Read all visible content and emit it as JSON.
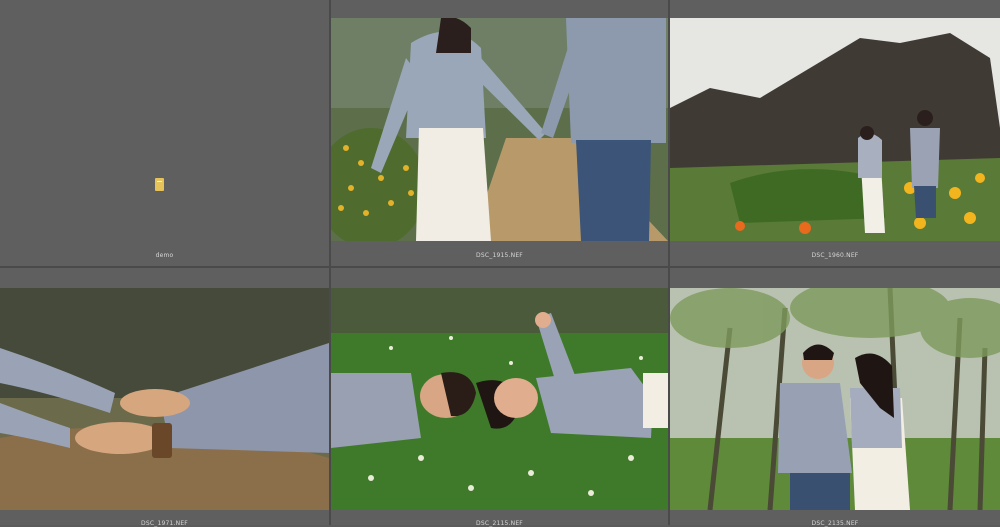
{
  "grid": {
    "cells": [
      {
        "caption": "demo",
        "kind": "folder"
      },
      {
        "caption": "DSC_1915.NEF",
        "kind": "photo"
      },
      {
        "caption": "DSC_1960.NEF",
        "kind": "photo"
      },
      {
        "caption": "DSC_1971.NEF",
        "kind": "photo"
      },
      {
        "caption": "DSC_2115.NEF",
        "kind": "photo"
      },
      {
        "caption": "DSC_2135.NEF",
        "kind": "photo"
      }
    ]
  },
  "colors": {
    "background": "#5f5f5f",
    "divider": "#4a4a4a",
    "caption_text": "#d6d6d6",
    "folder_icon": "#e6c35a"
  }
}
